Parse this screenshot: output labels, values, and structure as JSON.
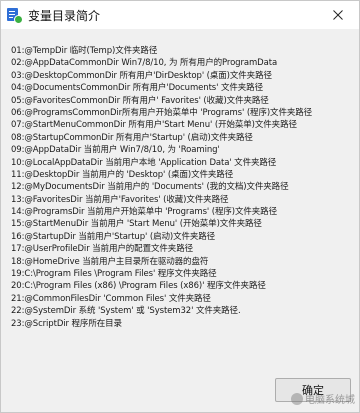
{
  "window": {
    "title": "变量目录简介",
    "title_icon": "document-check-icon"
  },
  "items": [
    "01:@TempDir  临时(Temp)文件夹路径",
    "02:@AppDataCommonDir  Win7/8/10, 为 所有用户的ProgramData",
    "03:@DesktopCommonDir  所有用户'DirDesktop' (桌面)文件夹路径",
    "04:@DocumentsCommonDir  所有用户'Documents' 文件夹路径",
    "05:@FavoritesCommonDir  所有用户' Favorites' (收藏)文件夹路径",
    "06:@ProgramsCommonDir所有用户开始菜单中 'Programs' (程序)文件夹路径",
    "07:@StartMenuCommonDir  所有用户'Start Menu' (开始菜单)文件夹路径",
    "08:@StartupCommonDir  所有用户'Startup' (启动)文件夹路径",
    "09:@AppDataDir  当前用户 Win7/8/10, 为 'Roaming'",
    "10:@LocalAppDataDir  当前用户本地 'Application Data' 文件夹路径",
    "11:@DesktopDir  当前用户的 'Desktop' (桌面)文件夹路径",
    "12:@MyDocumentsDir  当前用户的 'Documents' (我的文档)文件夹路径",
    "13:@FavoritesDir  当前用户'Favorites' (收藏)文件夹路径",
    "14:@ProgramsDir  当前用户开始菜单中 'Programs' (程序)文件夹路径",
    "15:@StartMenuDir  当前用户 'Start Menu' (开始菜单)文件夹路径",
    "16:@StartupDir  当前用户'Startup' (启动)文件夹路径",
    "17:@UserProfileDir  当前用户的配置文件夹路径",
    "18:@HomeDrive  当前用户主目录所在驱动器的盘符",
    "19:C:\\Program Files \\Program Files'  程序文件夹路径",
    "20:C:\\Program Files (x86) \\Program Files (x86)' 程序文件夹路径",
    "21:@CommonFilesDir  'Common Files' 文件夹路径",
    "22:@SystemDir  系统 'System' 或 'System32' 文件夹路径.",
    "23:@ScriptDir  程序所在目录"
  ],
  "footer": {
    "ok_label": "确定",
    "watermark": "电脑系统城"
  }
}
